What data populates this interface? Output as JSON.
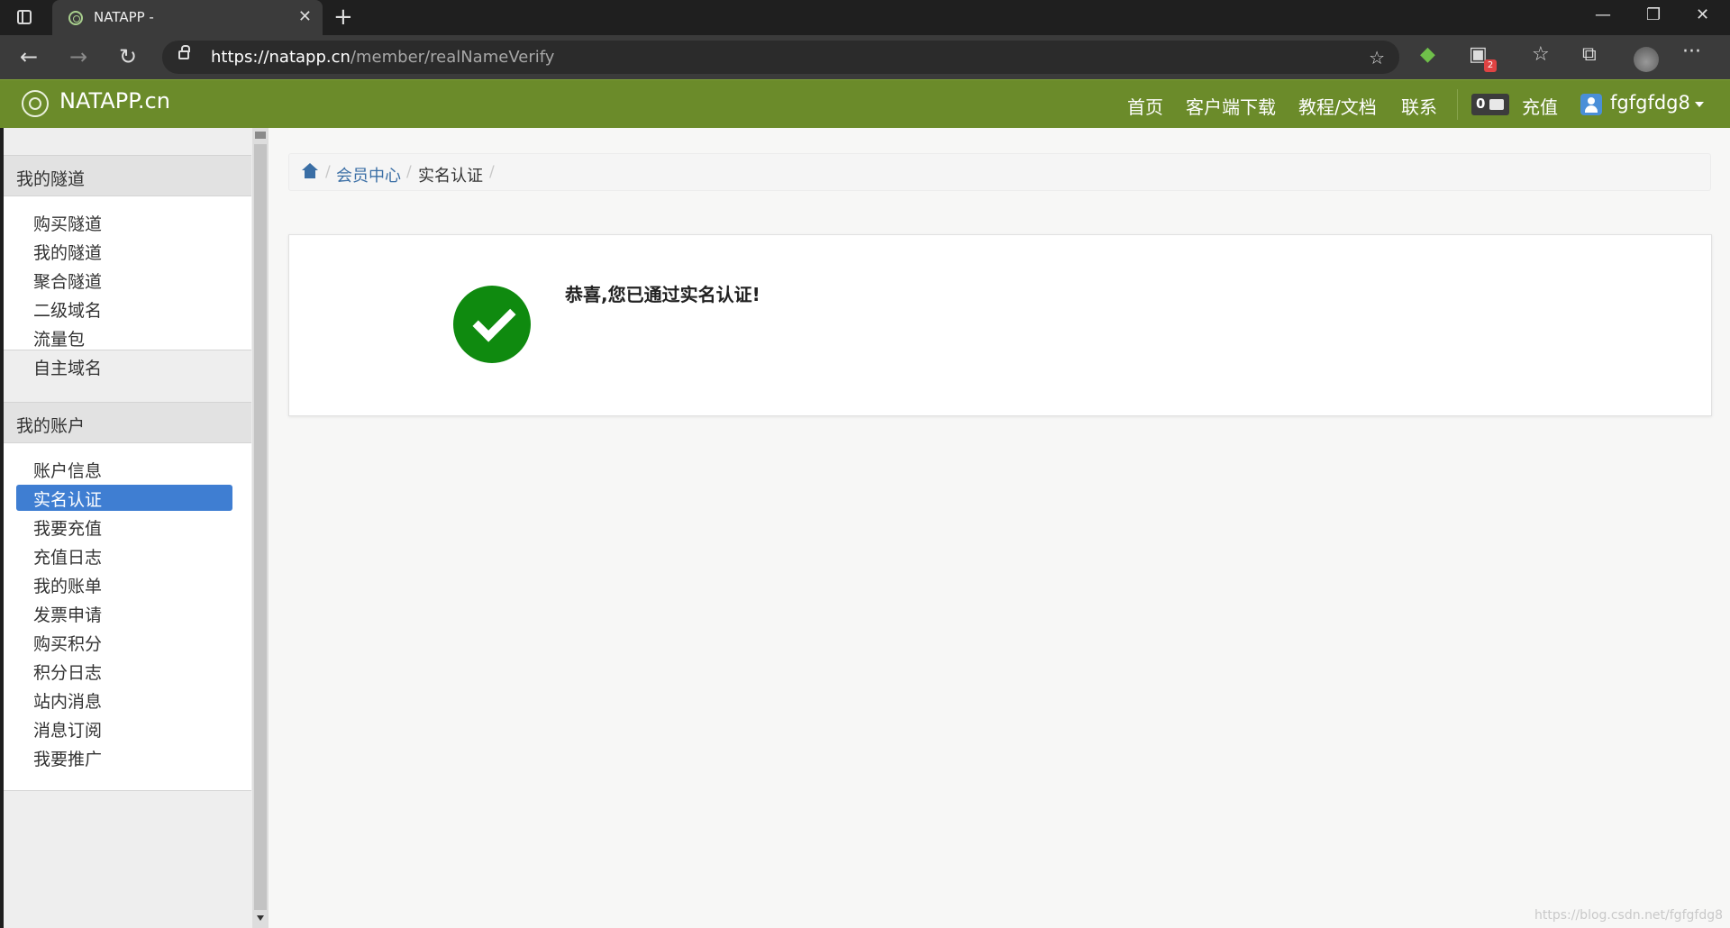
{
  "browser": {
    "tab_title": "NATAPP -",
    "tab_close": "✕",
    "new_tab": "+",
    "url_host": "https://natapp.cn",
    "url_path": "/member/realNameVerify",
    "extension_badge": "2",
    "window_controls": {
      "minimize": "—",
      "restore": "❐",
      "close": "✕"
    },
    "nav": {
      "back": "←",
      "forward": "→",
      "refresh": "↻"
    },
    "tools": {
      "favorites": "☆",
      "collections": "⧉",
      "more": "···",
      "fav_add": "☆"
    }
  },
  "header": {
    "logo_text": "NATAPP.cn",
    "nav": [
      "首页",
      "客户端下载",
      "教程/文档",
      "联系"
    ],
    "message_count": "0",
    "recharge": "充值",
    "username": "fgfgfdg8"
  },
  "sidebar": {
    "groups": [
      {
        "title": "我的隧道",
        "items": [
          "购买隧道",
          "我的隧道",
          "聚合隧道",
          "二级域名",
          "流量包",
          "自主域名"
        ]
      },
      {
        "title": "我的账户",
        "items": [
          "账户信息",
          "实名认证",
          "我要充值",
          "充值日志",
          "我的账单",
          "发票申请",
          "购买积分",
          "积分日志",
          "站内消息",
          "消息订阅",
          "我要推广"
        ],
        "active_index": 1
      }
    ]
  },
  "breadcrumb": {
    "items": [
      "会员中心",
      "实名认证"
    ],
    "divider": "/"
  },
  "content": {
    "success_message": "恭喜,您已通过实名认证!"
  },
  "watermark": "https://blog.csdn.net/fgfgfdg8",
  "colors": {
    "header_green": "#6b8b2a",
    "active_blue": "#3f7ed2",
    "success_green": "#0f8a0f",
    "link_blue": "#3a6ea5"
  }
}
